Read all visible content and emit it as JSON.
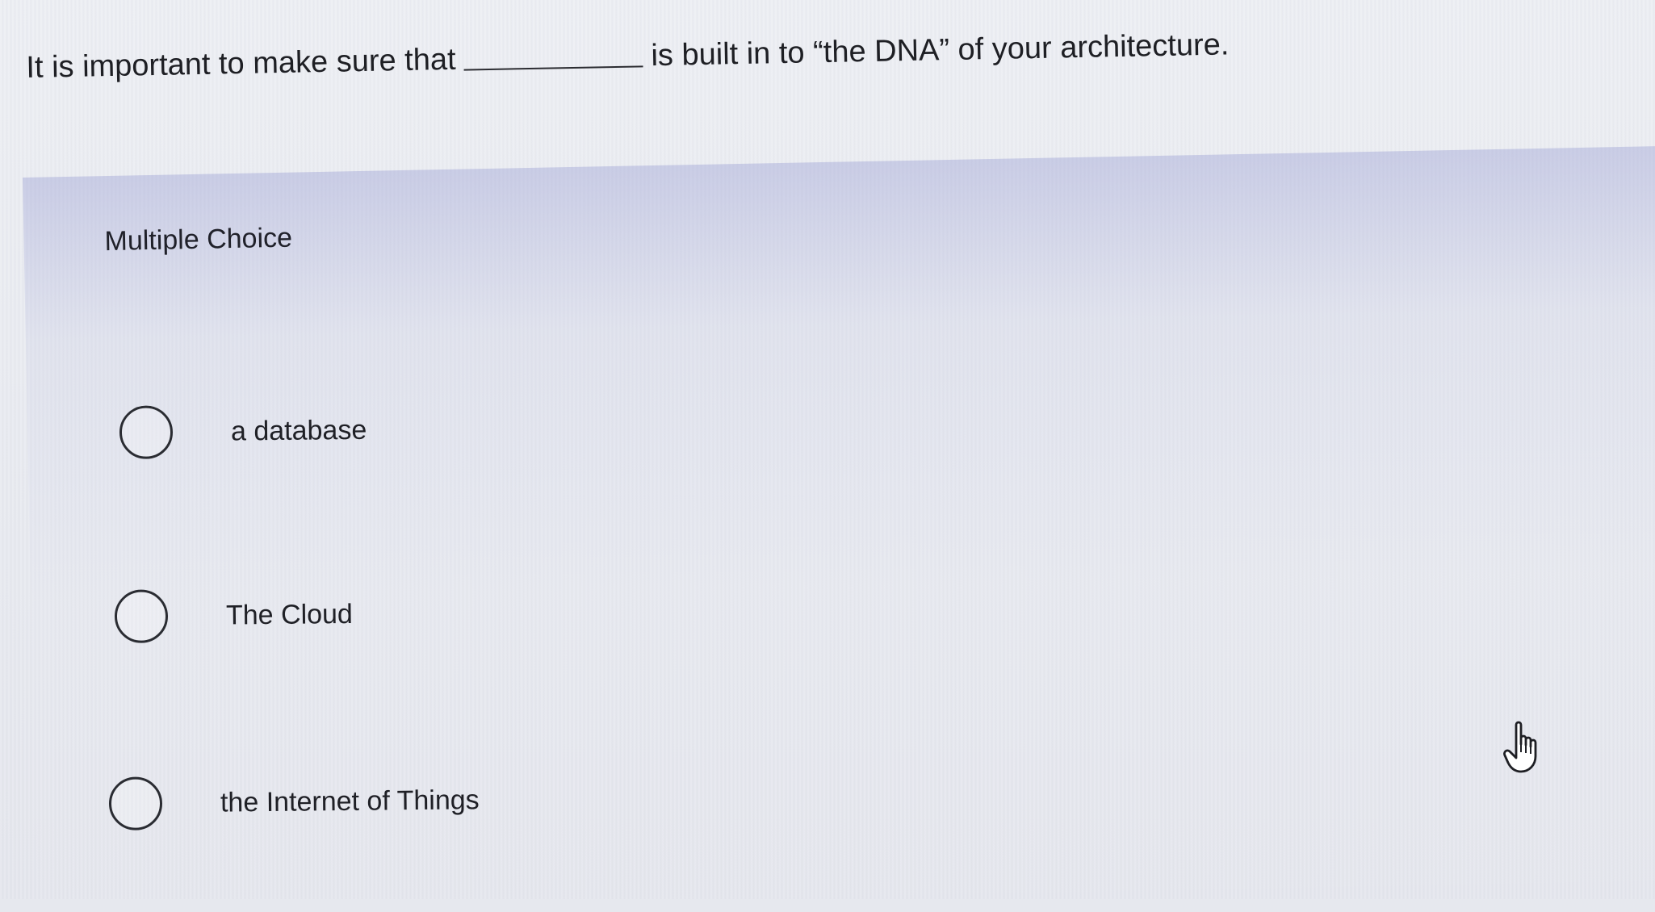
{
  "question": {
    "before_blank": "It is important to make sure that",
    "after_blank": "is built in to “the DNA” of your architecture."
  },
  "choice_section": {
    "label": "Multiple Choice",
    "options": [
      {
        "label": "a database",
        "selected": false
      },
      {
        "label": "The Cloud",
        "selected": false
      },
      {
        "label": "the Internet of Things",
        "selected": false
      }
    ]
  },
  "cursor": {
    "icon": "hand-pointer-icon"
  }
}
